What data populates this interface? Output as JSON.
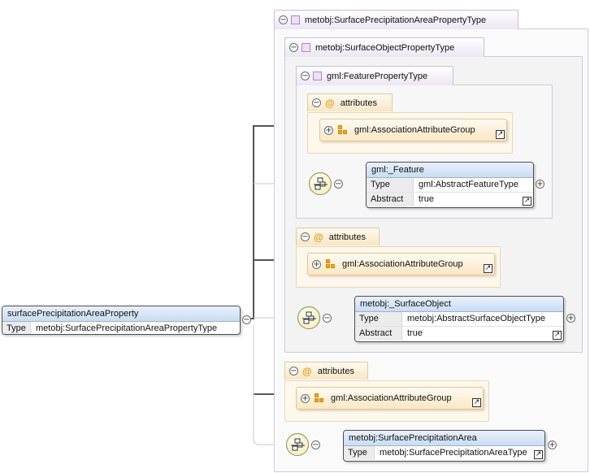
{
  "root": {
    "name": "metobj:SurfacePrecipitationAreaPropertyType",
    "surface_object": {
      "name": "metobj:SurfaceObjectPropertyType",
      "feature": {
        "name": "gml:FeaturePropertyType",
        "attributes": {
          "label": "attributes",
          "group": "gml:AssociationAttributeGroup"
        },
        "element": {
          "title": "gml:_Feature",
          "rows": [
            {
              "key": "Type",
              "value": "gml:AbstractFeatureType"
            },
            {
              "key": "Abstract",
              "value": "true"
            }
          ]
        }
      },
      "attributes": {
        "label": "attributes",
        "group": "gml:AssociationAttributeGroup"
      },
      "element": {
        "title": "metobj:_SurfaceObject",
        "rows": [
          {
            "key": "Type",
            "value": "metobj:AbstractSurfaceObjectType"
          },
          {
            "key": "Abstract",
            "value": "true"
          }
        ]
      }
    },
    "attributes": {
      "label": "attributes",
      "group": "gml:AssociationAttributeGroup"
    },
    "element": {
      "title": "metobj:SurfacePrecipitationArea",
      "rows": [
        {
          "key": "Type",
          "value": "metobj:SurfacePrecipitationAreaType"
        }
      ]
    }
  },
  "property": {
    "title": "surfacePrecipitationAreaProperty",
    "rows": [
      {
        "key": "Type",
        "value": "metobj:SurfacePrecipitationAreaPropertyType"
      }
    ]
  },
  "icons": {
    "collapse": "collapse-minus-icon",
    "expand": "expand-plus-icon",
    "complex_type": "complex-type-icon",
    "attribute": "at-sign-icon",
    "attribute_group": "attribute-group-icon",
    "sequence": "sequence-compositor-icon",
    "reference": "reference-arrow-icon"
  },
  "colors": {
    "type_header": "#ece6f3",
    "attributes_bg": "#fdf7ec",
    "attribute_icon": "#e39a12",
    "element_header": "#c9dcf3"
  }
}
